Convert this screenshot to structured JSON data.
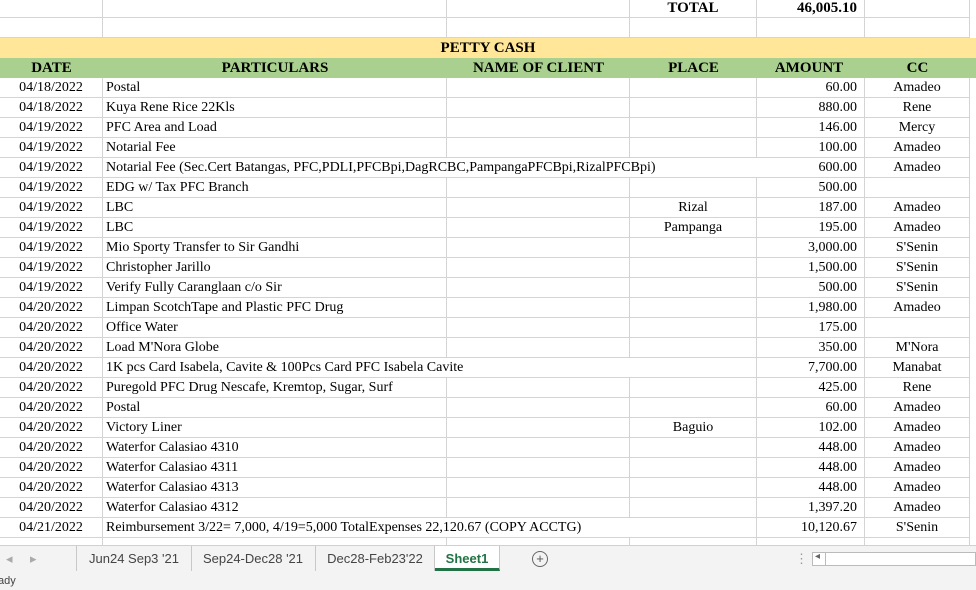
{
  "total": {
    "label": "TOTAL",
    "value": "46,005.10"
  },
  "title": "PETTY CASH",
  "headers": [
    "DATE",
    "PARTICULARS",
    "NAME OF CLIENT",
    "PLACE",
    "AMOUNT",
    "CC"
  ],
  "rows": [
    [
      "04/18/2022",
      "Postal",
      "",
      "",
      "60.00",
      "Amadeo"
    ],
    [
      "04/18/2022",
      "Kuya Rene Rice  22Kls",
      "",
      "",
      "880.00",
      "Rene"
    ],
    [
      "04/19/2022",
      "PFC Area and Load",
      "",
      "",
      "146.00",
      "Mercy"
    ],
    [
      "04/19/2022",
      "Notarial Fee",
      "",
      "",
      "100.00",
      "Amadeo"
    ],
    [
      "04/19/2022",
      "Notarial Fee (Sec.Cert Batangas, PFC,PDLI,PFCBpi,DagRCBC,PampangaPFCBpi,RizalPFCBpi)",
      "",
      "",
      "600.00",
      "Amadeo"
    ],
    [
      "04/19/2022",
      "EDG w/ Tax PFC Branch",
      "",
      "",
      "500.00",
      ""
    ],
    [
      "04/19/2022",
      "LBC",
      "",
      "Rizal",
      "187.00",
      "Amadeo"
    ],
    [
      "04/19/2022",
      "LBC",
      "",
      "Pampanga",
      "195.00",
      "Amadeo"
    ],
    [
      "04/19/2022",
      "Mio Sporty Transfer to Sir Gandhi",
      "",
      "",
      "3,000.00",
      "S'Senin"
    ],
    [
      "04/19/2022",
      "Christopher Jarillo",
      "",
      "",
      "1,500.00",
      "S'Senin"
    ],
    [
      "04/19/2022",
      "Verify Fully Caranglaan c/o Sir",
      "",
      "",
      "500.00",
      "S'Senin"
    ],
    [
      "04/20/2022",
      "Limpan ScotchTape and Plastic PFC Drug",
      "",
      "",
      "1,980.00",
      "Amadeo"
    ],
    [
      "04/20/2022",
      "Office Water",
      "",
      "",
      "175.00",
      ""
    ],
    [
      "04/20/2022",
      "Load M'Nora Globe",
      "",
      "",
      "350.00",
      "M'Nora"
    ],
    [
      "04/20/2022",
      "1K pcs Card Isabela, Cavite & 100Pcs Card PFC Isabela Cavite",
      "",
      "",
      "7,700.00",
      "Manabat"
    ],
    [
      "04/20/2022",
      "Puregold PFC Drug Nescafe, Kremtop, Sugar, Surf",
      "",
      "",
      "425.00",
      "Rene"
    ],
    [
      "04/20/2022",
      "Postal",
      "",
      "",
      "60.00",
      "Amadeo"
    ],
    [
      "04/20/2022",
      "Victory Liner",
      "",
      "Baguio",
      "102.00",
      "Amadeo"
    ],
    [
      "04/20/2022",
      "Waterfor Calasiao 4310",
      "",
      "",
      "448.00",
      "Amadeo"
    ],
    [
      "04/20/2022",
      "Waterfor Calasiao 4311",
      "",
      "",
      "448.00",
      "Amadeo"
    ],
    [
      "04/20/2022",
      "Waterfor Calasiao 4313",
      "",
      "",
      "448.00",
      "Amadeo"
    ],
    [
      "04/20/2022",
      "Waterfor Calasiao 4312",
      "",
      "",
      "1,397.20",
      "Amadeo"
    ],
    [
      "04/21/2022",
      "Reimbursement 3/22= 7,000, 4/19=5,000 TotalExpenses 22,120.67 (COPY ACCTG)",
      "",
      "",
      "10,120.67",
      "S'Senin"
    ]
  ],
  "sheet_tabs": [
    "Jun24 Sep3 '21",
    "Sep24-Dec28 '21",
    "Dec28-Feb23'22",
    "Sheet1"
  ],
  "active_tab": "Sheet1",
  "status": "Ready",
  "colors": {
    "title_fill": "#ffe699",
    "header_fill": "#a9d08e",
    "active_tab": "#217346"
  }
}
